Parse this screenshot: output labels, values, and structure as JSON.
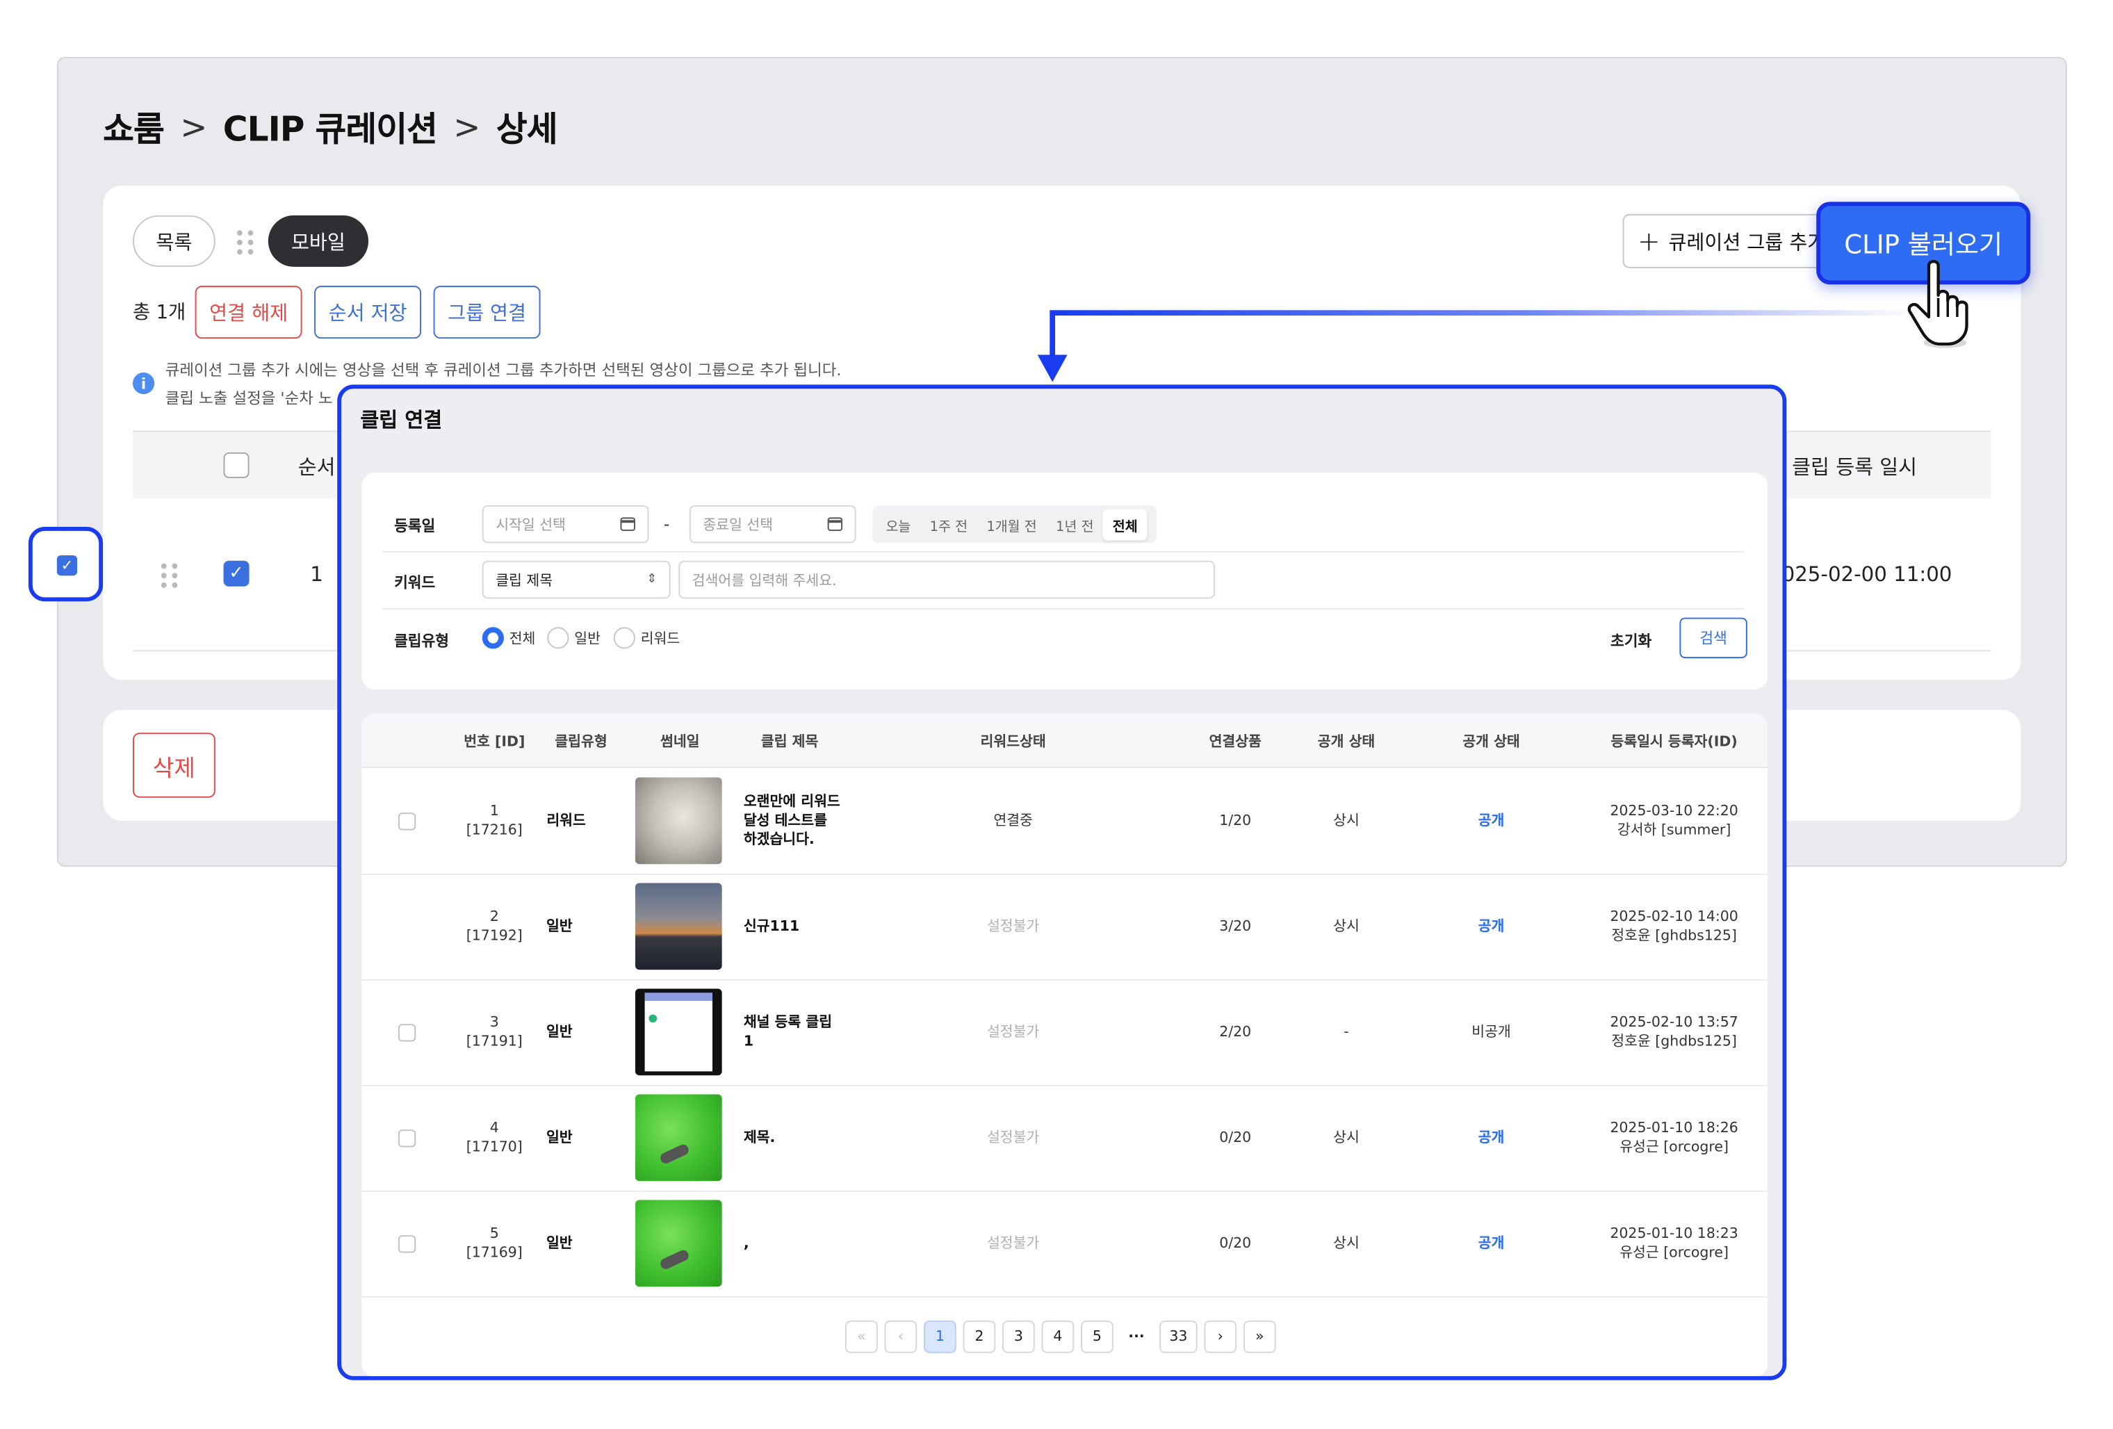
{
  "breadcrumb": {
    "part1": "쇼룸",
    "part2": "CLIP 큐레이션",
    "part3": "상세",
    "sep": ">"
  },
  "tabs": {
    "list": "목록",
    "mobile": "모바일"
  },
  "summary": {
    "count": "총 1개"
  },
  "actions": {
    "disconnect": "연결 해제",
    "save_order": "순서 저장",
    "group_link": "그룹 연결",
    "add_group": "큐레이션 그룹 추가",
    "load_clip": "CLIP 불러오기",
    "delete": "삭제"
  },
  "info": {
    "icon": "info-icon",
    "line1": "큐레이션 그룹 추가 시에는 영상을 선택 후 큐레이션 그룹 추가하면 선택된 영상이 그룹으로 추가 됩니다.",
    "line2": "클립 노출 설정을 '순차 노"
  },
  "bg_table": {
    "col_order": "순서",
    "col_registered": "클립 등록 일시",
    "row": {
      "order": "1",
      "registered": "2025-02-00 11:00"
    }
  },
  "modal": {
    "title": "클립 연결",
    "filter": {
      "reg_label": "등록일",
      "start_placeholder": "시작일 선택",
      "end_placeholder": "종료일 선택",
      "dash": "-",
      "ranges": [
        "오늘",
        "1주 전",
        "1개월 전",
        "1년 전",
        "전체"
      ],
      "active_range": "전체",
      "keyword_label": "키워드",
      "keyword_select": "클립 제목",
      "keyword_placeholder": "검색어를 입력해 주세요.",
      "type_label": "클립유형",
      "types": [
        "전체",
        "일반",
        "리워드"
      ],
      "reset": "초기화",
      "search": "검색"
    },
    "columns": [
      "번호 [ID]",
      "클립유형",
      "썸네일",
      "클립 제목",
      "리워드상태",
      "연결상품",
      "공개 상태",
      "공개 상태",
      "등록일시 등록자(ID)"
    ],
    "rows": [
      {
        "no": "1",
        "id": "[17216]",
        "type": "리워드",
        "title": "오랜만에 리워드 달성 테스트를 하겠습니다.",
        "reward": "연결중",
        "products": "1/20",
        "status1": "상시",
        "status2": "공개",
        "date": "2025-03-10 22:20",
        "user": "강서하 [summer]",
        "checked": false
      },
      {
        "no": "2",
        "id": "[17192]",
        "type": "일반",
        "title": "신규111",
        "reward": "설정불가",
        "products": "3/20",
        "status1": "상시",
        "status2": "공개",
        "date": "2025-02-10 14:00",
        "user": "정호윤 [ghdbs125]",
        "checked": true
      },
      {
        "no": "3",
        "id": "[17191]",
        "type": "일반",
        "title": "채널 등록 클립 1",
        "reward": "설정불가",
        "products": "2/20",
        "status1": "-",
        "status2": "비공개",
        "date": "2025-02-10 13:57",
        "user": "정호윤 [ghdbs125]",
        "checked": false
      },
      {
        "no": "4",
        "id": "[17170]",
        "type": "일반",
        "title": "제목.",
        "reward": "설정불가",
        "products": "0/20",
        "status1": "상시",
        "status2": "공개",
        "date": "2025-01-10 18:26",
        "user": "유성근 [orcogre]",
        "checked": false
      },
      {
        "no": "5",
        "id": "[17169]",
        "type": "일반",
        "title": ",",
        "reward": "설정불가",
        "products": "0/20",
        "status1": "상시",
        "status2": "공개",
        "date": "2025-01-10 18:23",
        "user": "유성근 [orcogre]",
        "checked": false
      }
    ],
    "pagination": {
      "first": "«",
      "prev": "‹",
      "pages": [
        "1",
        "2",
        "3",
        "4",
        "5"
      ],
      "ellipsis": "···",
      "last_page": "33",
      "next": "›",
      "last": "»",
      "current": "1"
    }
  },
  "colors": {
    "accent": "#2e6cf3",
    "highlight": "#1a3cf0",
    "danger": "#e34a4a"
  }
}
